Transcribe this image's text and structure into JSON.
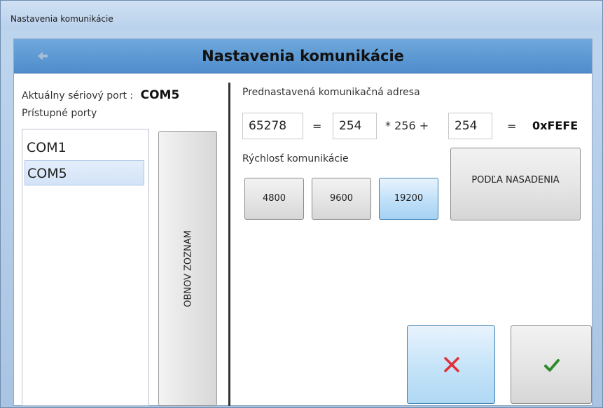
{
  "window": {
    "title": "Nastavenia komunikácie"
  },
  "header": {
    "title": "Nastavenia komunikácie",
    "back_icon": "arrow-left-icon"
  },
  "left": {
    "current_port_label": "Aktuálny sériový port :",
    "current_port_value": "COM5",
    "available_ports_label": "Prístupné porty",
    "ports": [
      "COM1",
      "COM5"
    ],
    "selected_port": "COM5",
    "refresh_button": "OBNOV ZOZNAM"
  },
  "address": {
    "label": "Prednastavená komunikačná adresa",
    "decimal": "65278",
    "eq1": "=",
    "high": "254",
    "mult": "* 256 +",
    "low": "254",
    "eq2": "=",
    "hex": "0xFEFE"
  },
  "speed": {
    "label": "Rýchlosť komunikácie",
    "options": [
      "4800",
      "9600",
      "19200"
    ],
    "selected": "19200",
    "deploy_button": "PODĽA NASADENIA"
  },
  "actions": {
    "cancel_icon": "close-icon",
    "ok_icon": "check-icon",
    "colors": {
      "cancel": "#e0303a",
      "ok": "#2e8b2e",
      "accent": "#4f8ccb"
    }
  }
}
